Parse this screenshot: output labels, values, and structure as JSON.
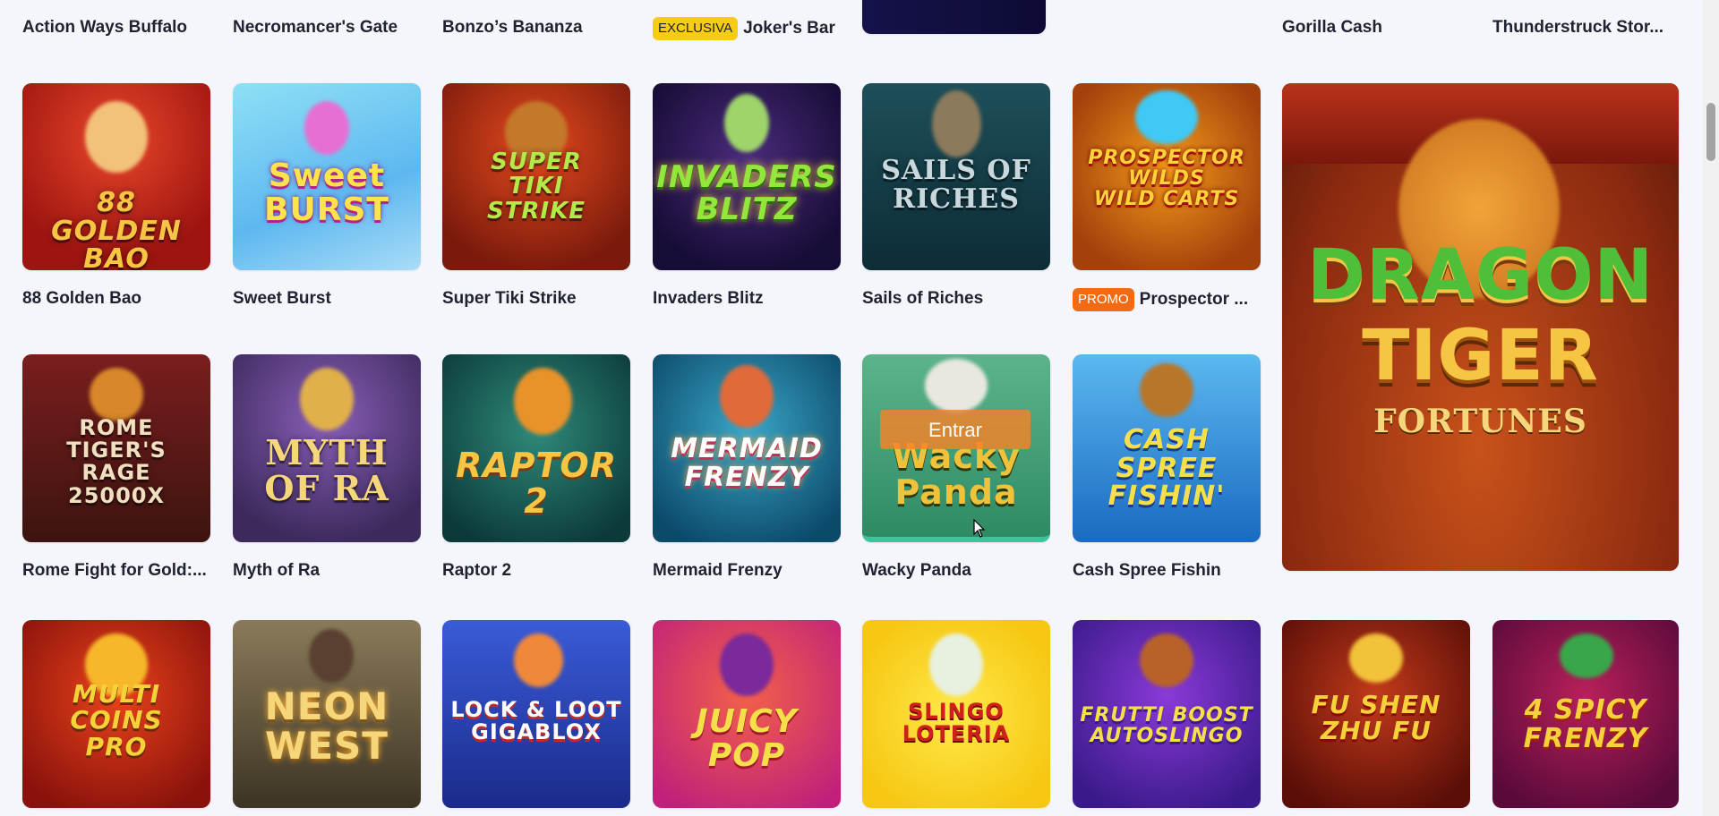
{
  "top_row": [
    {
      "title": "Action Ways Buffalo"
    },
    {
      "title": "Necromancer's Gate"
    },
    {
      "title": "Bonzo’s Bananza"
    },
    {
      "title": "Joker's Bar",
      "badge": "EXCLUSIVA"
    },
    {
      "title": "Gorilla Cash"
    },
    {
      "title": "Thunderstruck Stor..."
    }
  ],
  "row2": [
    {
      "title": "88 Golden Bao",
      "art": "88\nGOLDEN BAO"
    },
    {
      "title": "Sweet Burst",
      "art": "Sweet\nBURST"
    },
    {
      "title": "Super Tiki Strike",
      "art": "SUPER\nTIKI\nSTRIKE"
    },
    {
      "title": "Invaders Blitz",
      "art": "INVADERS\nBLITZ"
    },
    {
      "title": "Sails of Riches",
      "art": "SAILS of\nRICHES"
    },
    {
      "title": "Prospector ...",
      "badge": "PROMO",
      "art": "PROSPECTOR\nWILDS\nWILD CARTS"
    }
  ],
  "row3": [
    {
      "title": "Rome Fight for Gold:...",
      "art": "ROME\nTIGER'S\nRAGE\n25000X"
    },
    {
      "title": "Myth of Ra",
      "art": "MYTH\nOF RA"
    },
    {
      "title": "Raptor 2",
      "art": "RAPTOR 2"
    },
    {
      "title": "Mermaid Frenzy",
      "art": "MERMAID\nFRENZY"
    },
    {
      "title": "Wacky Panda",
      "art": "Wacky\nPanda",
      "hover_button": "Entrar"
    },
    {
      "title": "Cash Spree Fishin",
      "art": "CASH SPREE\nFISHIN'"
    }
  ],
  "featured": {
    "art_line1": "DRAGON",
    "art_line2": "TIGER",
    "art_line3": "FORTUNES"
  },
  "row4": [
    {
      "art": "MULTI\nCOINS\nPRO"
    },
    {
      "art": "NEON\nWEST"
    },
    {
      "art": "LOCK & LOOT\nGIGABLOX"
    },
    {
      "art": "JUICY\nPOP"
    },
    {
      "art": "SLINGO\nLOTERIA"
    },
    {
      "art": "FRUTTI BOOST\nAUTOSLINGO"
    },
    {
      "art": "FU SHEN\nZHU FU"
    },
    {
      "art": "4 SPICY\nFRENZY"
    }
  ],
  "colors": {
    "background": "#f4f6fb",
    "exclusive_badge": "#f6cc14",
    "promo_badge": "#f26a13",
    "entrar_overlay": "#f58228"
  },
  "icons": {
    "cursor": "mouse-pointer-icon"
  }
}
